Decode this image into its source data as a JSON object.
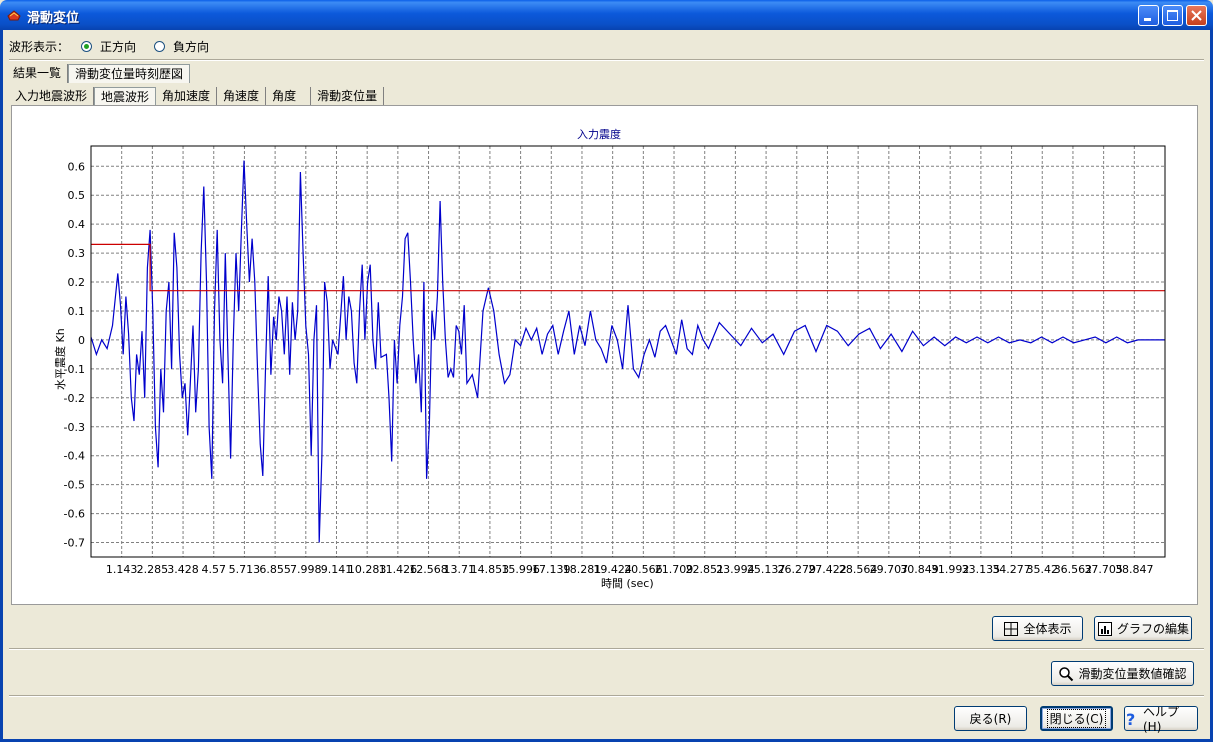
{
  "window": {
    "title": "滑動変位"
  },
  "wave_display": {
    "label": "波形表示：",
    "options": [
      "正方向",
      "負方向"
    ],
    "selected": "正方向"
  },
  "main_tabs": [
    {
      "label": "結果一覧"
    },
    {
      "label": "滑動変位量時刻歴図"
    }
  ],
  "sub_tabs": [
    {
      "label": "入力地震波形"
    },
    {
      "label": "地震波形"
    },
    {
      "label": "角加速度"
    },
    {
      "label": "角速度"
    },
    {
      "label": "角度"
    },
    {
      "label": "滑動変位量"
    }
  ],
  "buttons": {
    "full_view": "全体表示",
    "edit_graph": "グラフの編集",
    "check_values": "滑動変位量数値確認",
    "back": "戻る(R)",
    "close": "閉じる(C)",
    "help": "ヘルプ(H)"
  },
  "colors": {
    "series": "#0000CC",
    "threshold": "#CC0000",
    "title_bar": "#0A50C8"
  },
  "chart_data": {
    "type": "line",
    "title": "入力震度",
    "xlabel": "時間 (sec)",
    "ylabel": "水平震度 Kh",
    "ylim": [
      -0.75,
      0.67
    ],
    "xlim": [
      0,
      40
    ],
    "grid": true,
    "yticks": [
      0.6,
      0.5,
      0.4,
      0.3,
      0.2,
      0.1,
      0,
      -0.1,
      -0.2,
      -0.3,
      -0.4,
      -0.5,
      -0.6,
      -0.7
    ],
    "xticks": [
      "1.143",
      "2.285",
      "3.428",
      "4.57",
      "5.713",
      "6.855",
      "7.998",
      "9.141",
      "10.283",
      "11.426",
      "12.568",
      "13.71",
      "14.853",
      "15.996",
      "17.139",
      "18.281",
      "19.424",
      "20.566",
      "21.709",
      "22.851",
      "23.994",
      "25.137",
      "26.279",
      "27.422",
      "28.564",
      "29.707",
      "30.849",
      "31.992",
      "33.135",
      "34.277",
      "35.42",
      "36.562",
      "37.705",
      "38.847"
    ],
    "series": [
      {
        "values": [
          [
            0,
            0.01
          ],
          [
            0.2,
            -0.05
          ],
          [
            0.4,
            0.0
          ],
          [
            0.6,
            -0.03
          ],
          [
            0.8,
            0.05
          ],
          [
            1.0,
            0.23
          ],
          [
            1.1,
            0.12
          ],
          [
            1.2,
            -0.05
          ],
          [
            1.3,
            0.15
          ],
          [
            1.4,
            0.02
          ],
          [
            1.5,
            -0.2
          ],
          [
            1.6,
            -0.28
          ],
          [
            1.7,
            -0.05
          ],
          [
            1.8,
            -0.12
          ],
          [
            1.9,
            0.03
          ],
          [
            2.0,
            -0.2
          ],
          [
            2.1,
            0.25
          ],
          [
            2.2,
            0.38
          ],
          [
            2.3,
            0.1
          ],
          [
            2.4,
            -0.3
          ],
          [
            2.5,
            -0.44
          ],
          [
            2.6,
            -0.1
          ],
          [
            2.7,
            -0.25
          ],
          [
            2.8,
            0.1
          ],
          [
            2.9,
            0.2
          ],
          [
            3.0,
            -0.1
          ],
          [
            3.1,
            0.37
          ],
          [
            3.2,
            0.25
          ],
          [
            3.3,
            -0.05
          ],
          [
            3.4,
            -0.2
          ],
          [
            3.5,
            -0.15
          ],
          [
            3.6,
            -0.33
          ],
          [
            3.7,
            -0.15
          ],
          [
            3.8,
            0.05
          ],
          [
            3.9,
            -0.25
          ],
          [
            4.0,
            -0.1
          ],
          [
            4.1,
            0.3
          ],
          [
            4.2,
            0.53
          ],
          [
            4.3,
            0.2
          ],
          [
            4.4,
            -0.3
          ],
          [
            4.5,
            -0.48
          ],
          [
            4.6,
            0.1
          ],
          [
            4.7,
            0.38
          ],
          [
            4.8,
            0.0
          ],
          [
            4.9,
            -0.15
          ],
          [
            5.0,
            0.3
          ],
          [
            5.1,
            -0.05
          ],
          [
            5.2,
            -0.41
          ],
          [
            5.3,
            0.0
          ],
          [
            5.4,
            0.3
          ],
          [
            5.5,
            0.1
          ],
          [
            5.6,
            0.38
          ],
          [
            5.7,
            0.62
          ],
          [
            5.8,
            0.4
          ],
          [
            5.9,
            0.2
          ],
          [
            6.0,
            0.35
          ],
          [
            6.1,
            0.2
          ],
          [
            6.2,
            -0.1
          ],
          [
            6.3,
            -0.36
          ],
          [
            6.4,
            -0.47
          ],
          [
            6.5,
            -0.1
          ],
          [
            6.6,
            0.22
          ],
          [
            6.7,
            -0.12
          ],
          [
            6.8,
            0.08
          ],
          [
            6.9,
            0.0
          ],
          [
            7.0,
            0.15
          ],
          [
            7.1,
            0.1
          ],
          [
            7.2,
            -0.05
          ],
          [
            7.3,
            0.15
          ],
          [
            7.4,
            -0.12
          ],
          [
            7.5,
            0.13
          ],
          [
            7.6,
            0.0
          ],
          [
            7.7,
            0.1
          ],
          [
            7.8,
            0.58
          ],
          [
            7.9,
            0.3
          ],
          [
            8.0,
            0.05
          ],
          [
            8.1,
            -0.05
          ],
          [
            8.2,
            -0.4
          ],
          [
            8.3,
            0.0
          ],
          [
            8.4,
            0.12
          ],
          [
            8.5,
            -0.7
          ],
          [
            8.6,
            -0.4
          ],
          [
            8.7,
            0.2
          ],
          [
            8.8,
            0.13
          ],
          [
            8.9,
            -0.1
          ],
          [
            9.0,
            0.0
          ],
          [
            9.2,
            -0.05
          ],
          [
            9.4,
            0.22
          ],
          [
            9.5,
            0.0
          ],
          [
            9.6,
            0.15
          ],
          [
            9.7,
            0.1
          ],
          [
            9.8,
            -0.08
          ],
          [
            9.9,
            -0.15
          ],
          [
            10.0,
            0.1
          ],
          [
            10.1,
            0.26
          ],
          [
            10.2,
            0.0
          ],
          [
            10.3,
            0.2
          ],
          [
            10.4,
            0.26
          ],
          [
            10.5,
            0.0
          ],
          [
            10.6,
            -0.1
          ],
          [
            10.7,
            0.13
          ],
          [
            10.8,
            -0.06
          ],
          [
            11.0,
            -0.05
          ],
          [
            11.1,
            -0.2
          ],
          [
            11.2,
            -0.42
          ],
          [
            11.3,
            0.0
          ],
          [
            11.4,
            -0.15
          ],
          [
            11.5,
            0.05
          ],
          [
            11.6,
            0.15
          ],
          [
            11.7,
            0.35
          ],
          [
            11.8,
            0.37
          ],
          [
            11.9,
            0.2
          ],
          [
            12.0,
            0.0
          ],
          [
            12.1,
            -0.15
          ],
          [
            12.2,
            -0.05
          ],
          [
            12.3,
            -0.25
          ],
          [
            12.4,
            0.2
          ],
          [
            12.5,
            -0.48
          ],
          [
            12.6,
            -0.3
          ],
          [
            12.7,
            0.1
          ],
          [
            12.8,
            0.0
          ],
          [
            12.9,
            0.15
          ],
          [
            13.0,
            0.48
          ],
          [
            13.1,
            0.2
          ],
          [
            13.2,
            0.0
          ],
          [
            13.3,
            -0.13
          ],
          [
            13.4,
            -0.1
          ],
          [
            13.5,
            -0.13
          ],
          [
            13.6,
            0.05
          ],
          [
            13.7,
            0.03
          ],
          [
            13.8,
            -0.05
          ],
          [
            13.9,
            0.12
          ],
          [
            14.0,
            -0.15
          ],
          [
            14.2,
            -0.12
          ],
          [
            14.4,
            -0.2
          ],
          [
            14.6,
            0.1
          ],
          [
            14.8,
            0.18
          ],
          [
            15.0,
            0.1
          ],
          [
            15.2,
            -0.05
          ],
          [
            15.4,
            -0.15
          ],
          [
            15.6,
            -0.12
          ],
          [
            15.8,
            0.0
          ],
          [
            16.0,
            -0.02
          ],
          [
            16.2,
            0.04
          ],
          [
            16.4,
            0.0
          ],
          [
            16.6,
            0.04
          ],
          [
            16.8,
            -0.05
          ],
          [
            17.0,
            0.02
          ],
          [
            17.2,
            0.05
          ],
          [
            17.4,
            -0.05
          ],
          [
            17.6,
            0.03
          ],
          [
            17.8,
            0.1
          ],
          [
            18.0,
            -0.05
          ],
          [
            18.2,
            0.05
          ],
          [
            18.4,
            -0.02
          ],
          [
            18.6,
            0.1
          ],
          [
            18.8,
            0.0
          ],
          [
            19.0,
            -0.03
          ],
          [
            19.2,
            -0.08
          ],
          [
            19.4,
            0.05
          ],
          [
            19.6,
            0.0
          ],
          [
            19.8,
            -0.1
          ],
          [
            20.0,
            0.12
          ],
          [
            20.2,
            -0.1
          ],
          [
            20.4,
            -0.13
          ],
          [
            20.6,
            -0.05
          ],
          [
            20.8,
            0.0
          ],
          [
            21.0,
            -0.06
          ],
          [
            21.2,
            0.03
          ],
          [
            21.4,
            0.05
          ],
          [
            21.6,
            0.0
          ],
          [
            21.8,
            -0.05
          ],
          [
            22.0,
            0.07
          ],
          [
            22.2,
            -0.03
          ],
          [
            22.4,
            -0.05
          ],
          [
            22.6,
            0.05
          ],
          [
            22.8,
            0.0
          ],
          [
            23.0,
            -0.03
          ],
          [
            23.4,
            0.06
          ],
          [
            23.8,
            0.02
          ],
          [
            24.2,
            -0.02
          ],
          [
            24.6,
            0.04
          ],
          [
            25.0,
            -0.01
          ],
          [
            25.4,
            0.02
          ],
          [
            25.8,
            -0.05
          ],
          [
            26.2,
            0.03
          ],
          [
            26.6,
            0.05
          ],
          [
            27.0,
            -0.04
          ],
          [
            27.4,
            0.05
          ],
          [
            27.8,
            0.03
          ],
          [
            28.2,
            -0.02
          ],
          [
            28.6,
            0.02
          ],
          [
            29.0,
            0.04
          ],
          [
            29.4,
            -0.03
          ],
          [
            29.8,
            0.02
          ],
          [
            30.2,
            -0.04
          ],
          [
            30.6,
            0.03
          ],
          [
            31.0,
            -0.02
          ],
          [
            31.4,
            0.01
          ],
          [
            31.8,
            -0.02
          ],
          [
            32.2,
            0.01
          ],
          [
            32.6,
            -0.01
          ],
          [
            33.0,
            0.01
          ],
          [
            33.4,
            -0.01
          ],
          [
            33.8,
            0.01
          ],
          [
            34.2,
            -0.01
          ],
          [
            34.6,
            0.0
          ],
          [
            35.0,
            -0.01
          ],
          [
            35.4,
            0.01
          ],
          [
            35.8,
            -0.01
          ],
          [
            36.2,
            0.01
          ],
          [
            36.6,
            -0.01
          ],
          [
            37.0,
            0.0
          ],
          [
            37.4,
            0.01
          ],
          [
            37.8,
            -0.01
          ],
          [
            38.2,
            0.01
          ],
          [
            38.6,
            -0.01
          ],
          [
            39.0,
            0.0
          ],
          [
            40.0,
            0.0
          ]
        ]
      },
      {
        "values": [
          [
            0,
            0.33
          ],
          [
            2.2,
            0.33
          ],
          [
            2.2,
            0.17
          ],
          [
            40,
            0.17
          ]
        ]
      }
    ]
  }
}
